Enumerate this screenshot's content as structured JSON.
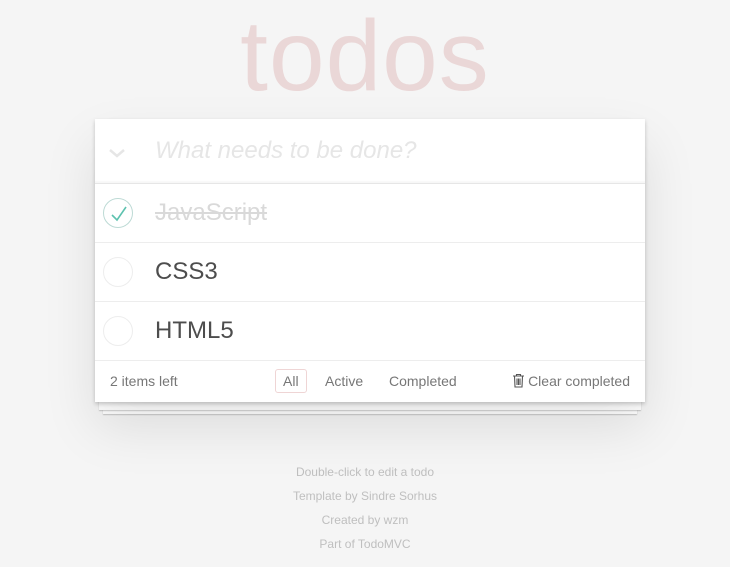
{
  "app": {
    "title": "todos"
  },
  "header": {
    "placeholder": "What needs to be done?"
  },
  "todos": [
    {
      "label": "JavaScript",
      "completed": true
    },
    {
      "label": "CSS3",
      "completed": false
    },
    {
      "label": "HTML5",
      "completed": false
    }
  ],
  "footer": {
    "count_label": "2 items left",
    "filters": [
      "All",
      "Active",
      "Completed"
    ],
    "selected_filter": "All",
    "clear_label": "Clear completed"
  },
  "info": [
    "Double-click to edit a todo",
    "Template by Sindre Sorhus",
    "Created by wzm",
    "Part of TodoMVC"
  ],
  "colors": {
    "check": "#5dc2af",
    "title": "#eaeaea"
  }
}
